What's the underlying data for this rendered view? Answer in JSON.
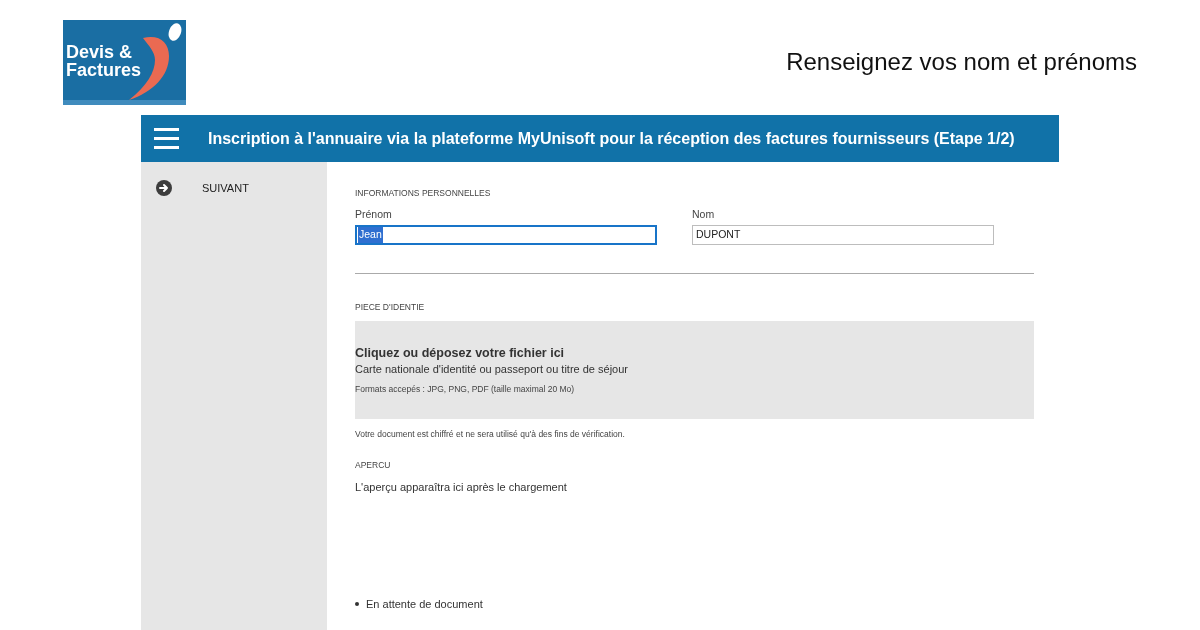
{
  "logo": {
    "lines": [
      "Devis &",
      "Factures"
    ]
  },
  "page_heading": "Renseignez vos nom et prénoms",
  "header": {
    "title": "Inscription à l'annuaire via la plateforme MyUnisoft pour la réception des factures fournisseurs (Etape 1/2)"
  },
  "sidebar": {
    "items": [
      {
        "label": "SUIVANT"
      }
    ]
  },
  "personal_info": {
    "heading": "INFORMATIONS PERSONNELLES",
    "fields": [
      {
        "label": "Prénom",
        "value": "Jean",
        "focused": true
      },
      {
        "label": "Nom",
        "value": "DUPONT",
        "focused": false
      }
    ]
  },
  "id_document": {
    "heading": "PIECE D'IDENTIE",
    "dropzone": {
      "title": "Cliquez ou déposez votre fichier ici",
      "subtitle": "Carte nationale d'identité ou passeport ou titre de séjour",
      "formats": "Formats accepés : JPG, PNG, PDF (taille maximal 20 Mo)"
    },
    "notice": "Votre document est chiffré et ne sera utilisé qu'à des fins de vérification."
  },
  "preview": {
    "heading": "APERCU",
    "message": "L'aperçu apparaîtra ici après le chargement"
  },
  "status": {
    "text": "En attente de document"
  }
}
